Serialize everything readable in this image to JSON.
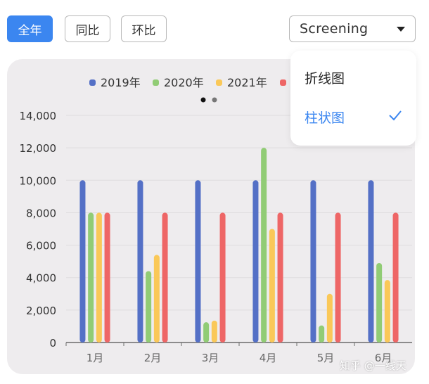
{
  "toolbar": {
    "all_label": "全年",
    "yoy_label": "同比",
    "mom_label": "环比"
  },
  "screening": {
    "label": "Screening",
    "icon": "caret-down-icon"
  },
  "menu": {
    "items": [
      {
        "label": "折线图",
        "selected": false
      },
      {
        "label": "柱状图",
        "selected": true
      }
    ],
    "check_icon": "check-icon"
  },
  "pager": {
    "dots": 2,
    "active": 0
  },
  "watermark": "知乎 @一线天",
  "colors": {
    "accent": "#3b86f0"
  },
  "chart_data": {
    "type": "bar",
    "categories": [
      "1月",
      "2月",
      "3月",
      "4月",
      "5月",
      "6月"
    ],
    "series": [
      {
        "name": "2019年",
        "color": "#5470c6",
        "values": [
          10000,
          10000,
          10000,
          10000,
          10000,
          10000
        ]
      },
      {
        "name": "2020年",
        "color": "#91cc75",
        "values": [
          8000,
          4400,
          1250,
          12000,
          1050,
          4900
        ]
      },
      {
        "name": "2021年",
        "color": "#fac858",
        "values": [
          8000,
          5400,
          1350,
          7000,
          3000,
          3850
        ]
      },
      {
        "name": "",
        "color": "#ee6666",
        "values": [
          8000,
          8000,
          8000,
          8000,
          8000,
          8000
        ]
      }
    ],
    "y_ticks": [
      "0",
      "2,000",
      "4,000",
      "6,000",
      "8,000",
      "10,000",
      "12,000",
      "14,000"
    ],
    "ylim": [
      0,
      14000
    ],
    "grid": true,
    "legend_position": "top"
  }
}
